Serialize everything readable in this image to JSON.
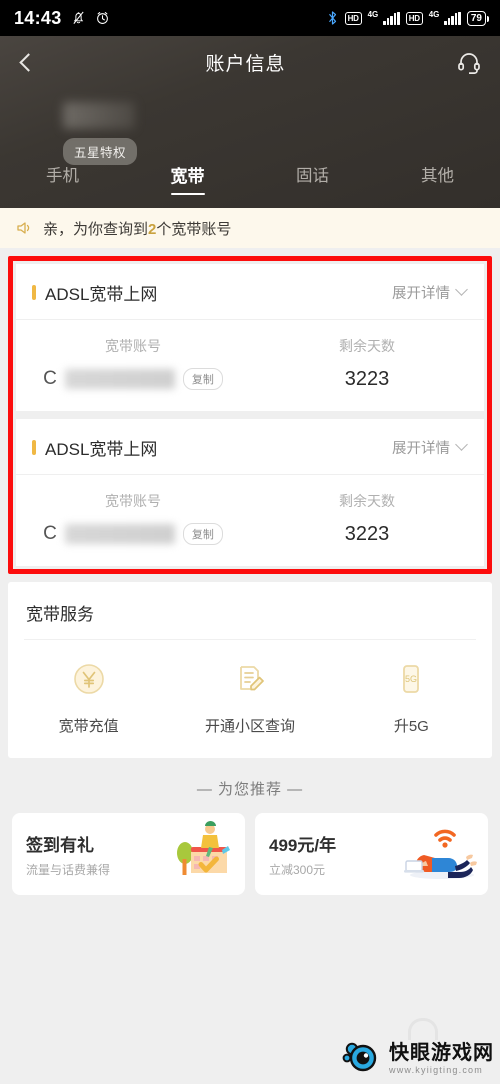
{
  "status_bar": {
    "time": "14:43",
    "icons_left": [
      "mute-bell-icon",
      "alarm-clock-icon"
    ],
    "bluetooth": "bluetooth-icon",
    "sim1_hd": "HD",
    "sim1_net": "4G",
    "sim2_hd": "HD",
    "sim2_net": "4G",
    "battery": "79"
  },
  "header": {
    "back_icon": "back-chevron-icon",
    "title": "账户信息",
    "service_icon": "headset-icon",
    "badge": "五星特权",
    "tabs": [
      {
        "label": "手机",
        "active": false
      },
      {
        "label": "宽带",
        "active": true
      },
      {
        "label": "固话",
        "active": false
      },
      {
        "label": "其他",
        "active": false
      }
    ]
  },
  "notice": {
    "icon": "speaker-icon",
    "prefix": "亲，为你查询到",
    "count": "2",
    "suffix": "个宽带账号"
  },
  "accounts": [
    {
      "title": "ADSL宽带上网",
      "expand_label": "展开详情",
      "account_label": "宽带账号",
      "account_value": "",
      "copy_label": "复制",
      "days_label": "剩余天数",
      "days_value": "3223"
    },
    {
      "title": "ADSL宽带上网",
      "expand_label": "展开详情",
      "account_label": "宽带账号",
      "account_value": "",
      "copy_label": "复制",
      "days_label": "剩余天数",
      "days_value": "3223"
    }
  ],
  "services": {
    "title": "宽带服务",
    "items": [
      {
        "label": "宽带充值",
        "icon": "yuan-coin-icon"
      },
      {
        "label": "开通小区查询",
        "icon": "document-pencil-icon"
      },
      {
        "label": "升5G",
        "icon": "phone-5g-icon"
      }
    ]
  },
  "recommend": {
    "heading": "— 为您推荐 —",
    "cards": [
      {
        "title": "签到有礼",
        "subtitle": "流量与话费兼得",
        "illustration": "calendar-checkin-illustration"
      },
      {
        "title": "499元/年",
        "subtitle": "立减300元",
        "illustration": "wifi-person-laptop-illustration"
      }
    ]
  },
  "watermark": {
    "name": "快眼游戏网",
    "url": "www.kyiigting.com",
    "logo": "blue-eye-logo"
  },
  "colors": {
    "accent_gold": "#f0b844",
    "notice_bg": "#fdf8ec",
    "annotation_red": "#fc0d0d",
    "header_dark": "#3b3732"
  }
}
